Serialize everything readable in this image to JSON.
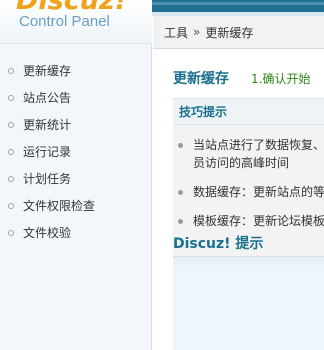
{
  "logo": {
    "brand": "Discuz!",
    "subtitle": "Control Panel"
  },
  "sidebar": {
    "items": [
      {
        "label": "更新缓存"
      },
      {
        "label": "站点公告"
      },
      {
        "label": "更新统计"
      },
      {
        "label": "运行记录"
      },
      {
        "label": "计划任务"
      },
      {
        "label": "文件权限检查"
      },
      {
        "label": "文件校验"
      }
    ]
  },
  "breadcrumb": {
    "root": "工具",
    "separator": "»",
    "current": "更新缓存"
  },
  "main": {
    "title": "更新缓存",
    "step": "1.确认开始",
    "tips": {
      "header": "技巧提示",
      "items": [
        {
          "text": "当站点进行了数据恢复、"
        },
        {
          "text": "员访问的高峰时间"
        },
        {
          "text": "数据缓存：更新站点的等"
        },
        {
          "text": "模板缓存：更新论坛模板"
        }
      ]
    },
    "discuz_tip_title": "Discuz! 提示"
  },
  "colors": {
    "accent": "#1b6f8f",
    "step_green": "#2e8b16",
    "logo_orange": "#f0a21b",
    "top_bar": "#1e6f91"
  }
}
